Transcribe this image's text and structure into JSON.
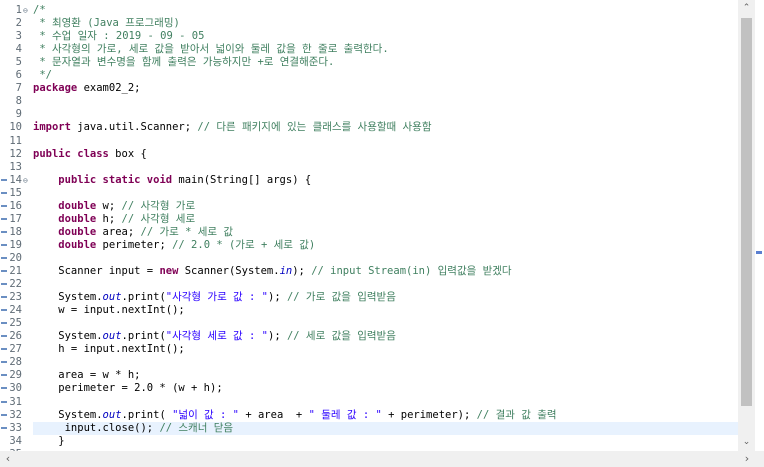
{
  "editor": {
    "lines": [
      {
        "n": "1",
        "fold": "⊖",
        "parts": [
          {
            "c": "cm",
            "t": "/*"
          }
        ]
      },
      {
        "n": "2",
        "parts": [
          {
            "c": "cm",
            "t": " * 최영환 (Java 프로그래밍)"
          }
        ]
      },
      {
        "n": "3",
        "parts": [
          {
            "c": "cm",
            "t": " * 수업 일자 : 2019 - 09 - 05"
          }
        ]
      },
      {
        "n": "4",
        "parts": [
          {
            "c": "cm",
            "t": " * 사각형의 가로, 세로 값을 받아서 넓이와 둘레 값을 한 줄로 출력한다."
          }
        ]
      },
      {
        "n": "5",
        "parts": [
          {
            "c": "cm",
            "t": " * 문자열과 변수명을 함께 출력은 가능하지만 +로 연결해준다."
          }
        ]
      },
      {
        "n": "6",
        "parts": [
          {
            "c": "cm",
            "t": " */"
          }
        ]
      },
      {
        "n": "7",
        "parts": [
          {
            "c": "kw",
            "t": "package"
          },
          {
            "c": "",
            "t": " exam02_2;"
          }
        ]
      },
      {
        "n": "8",
        "parts": []
      },
      {
        "n": "9",
        "parts": []
      },
      {
        "n": "10",
        "parts": [
          {
            "c": "kw",
            "t": "import"
          },
          {
            "c": "",
            "t": " java.util.Scanner; "
          },
          {
            "c": "cm",
            "t": "// 다른 패키지에 있는 클래스를 사용할때 사용함"
          }
        ]
      },
      {
        "n": "11",
        "parts": []
      },
      {
        "n": "12",
        "parts": [
          {
            "c": "kw",
            "t": "public class"
          },
          {
            "c": "",
            "t": " box {"
          }
        ]
      },
      {
        "n": "13",
        "parts": []
      },
      {
        "n": "14",
        "fold": "⊖",
        "parts": [
          {
            "c": "",
            "t": "    "
          },
          {
            "c": "kw",
            "t": "public static void"
          },
          {
            "c": "",
            "t": " main(String[] args) {"
          }
        ]
      },
      {
        "n": "15",
        "parts": []
      },
      {
        "n": "16",
        "parts": [
          {
            "c": "",
            "t": "    "
          },
          {
            "c": "kw",
            "t": "double"
          },
          {
            "c": "",
            "t": " w; "
          },
          {
            "c": "cm",
            "t": "// 사각형 가로"
          }
        ]
      },
      {
        "n": "17",
        "parts": [
          {
            "c": "",
            "t": "    "
          },
          {
            "c": "kw",
            "t": "double"
          },
          {
            "c": "",
            "t": " h; "
          },
          {
            "c": "cm",
            "t": "// 사각형 세로"
          }
        ]
      },
      {
        "n": "18",
        "parts": [
          {
            "c": "",
            "t": "    "
          },
          {
            "c": "kw",
            "t": "double"
          },
          {
            "c": "",
            "t": " area; "
          },
          {
            "c": "cm",
            "t": "// 가로 * 세로 값"
          }
        ]
      },
      {
        "n": "19",
        "parts": [
          {
            "c": "",
            "t": "    "
          },
          {
            "c": "kw",
            "t": "double"
          },
          {
            "c": "",
            "t": " perimeter; "
          },
          {
            "c": "cm",
            "t": "// 2.0 * (가로 + 세로 값)"
          }
        ]
      },
      {
        "n": "20",
        "parts": []
      },
      {
        "n": "21",
        "parts": [
          {
            "c": "",
            "t": "    Scanner input = "
          },
          {
            "c": "kw",
            "t": "new"
          },
          {
            "c": "",
            "t": " Scanner(System."
          },
          {
            "c": "fs",
            "t": "in"
          },
          {
            "c": "",
            "t": "); "
          },
          {
            "c": "cm",
            "t": "// input Stream(in) 입력값을 받겠다"
          }
        ]
      },
      {
        "n": "22",
        "parts": []
      },
      {
        "n": "23",
        "parts": [
          {
            "c": "",
            "t": "    System."
          },
          {
            "c": "fs",
            "t": "out"
          },
          {
            "c": "",
            "t": ".print("
          },
          {
            "c": "st",
            "t": "\"사각형 가로 값 : \""
          },
          {
            "c": "",
            "t": "); "
          },
          {
            "c": "cm",
            "t": "// 가로 값을 입력받음"
          }
        ]
      },
      {
        "n": "24",
        "parts": [
          {
            "c": "",
            "t": "    w = input.nextInt();"
          }
        ]
      },
      {
        "n": "25",
        "parts": []
      },
      {
        "n": "26",
        "parts": [
          {
            "c": "",
            "t": "    System."
          },
          {
            "c": "fs",
            "t": "out"
          },
          {
            "c": "",
            "t": ".print("
          },
          {
            "c": "st",
            "t": "\"사각형 세로 값 : \""
          },
          {
            "c": "",
            "t": "); "
          },
          {
            "c": "cm",
            "t": "// 세로 값을 입력받음"
          }
        ]
      },
      {
        "n": "27",
        "parts": [
          {
            "c": "",
            "t": "    h = input.nextInt();"
          }
        ]
      },
      {
        "n": "28",
        "parts": []
      },
      {
        "n": "29",
        "parts": [
          {
            "c": "",
            "t": "    area = w * h;"
          }
        ]
      },
      {
        "n": "30",
        "parts": [
          {
            "c": "",
            "t": "    perimeter = 2.0 * (w + h);"
          }
        ]
      },
      {
        "n": "31",
        "parts": []
      },
      {
        "n": "32",
        "parts": [
          {
            "c": "",
            "t": "    System."
          },
          {
            "c": "fs",
            "t": "out"
          },
          {
            "c": "",
            "t": ".print( "
          },
          {
            "c": "st",
            "t": "\"넓이 값 : \""
          },
          {
            "c": "",
            "t": " + area  + "
          },
          {
            "c": "st",
            "t": "\" 둘레 값 : \""
          },
          {
            "c": "",
            "t": " + perimeter); "
          },
          {
            "c": "cm",
            "t": "// 결과 값 출력"
          }
        ]
      },
      {
        "n": "33",
        "current": true,
        "parts": [
          {
            "c": "",
            "t": "     input.close(); "
          },
          {
            "c": "cm",
            "t": "// 스캐너 닫음"
          }
        ]
      },
      {
        "n": "34",
        "parts": [
          {
            "c": "",
            "t": "    }"
          }
        ]
      },
      {
        "n": "35",
        "parts": []
      }
    ]
  },
  "scrollbars": {
    "vertical_up": "⌃",
    "vertical_down": "⌄",
    "horizontal_left": "‹",
    "horizontal_right": "›"
  },
  "colors": {
    "keyword": "#7f0055",
    "comment": "#3f7f5f",
    "string": "#2a00ff",
    "static_field": "#0000c0",
    "current_line": "#e8f2fe"
  }
}
